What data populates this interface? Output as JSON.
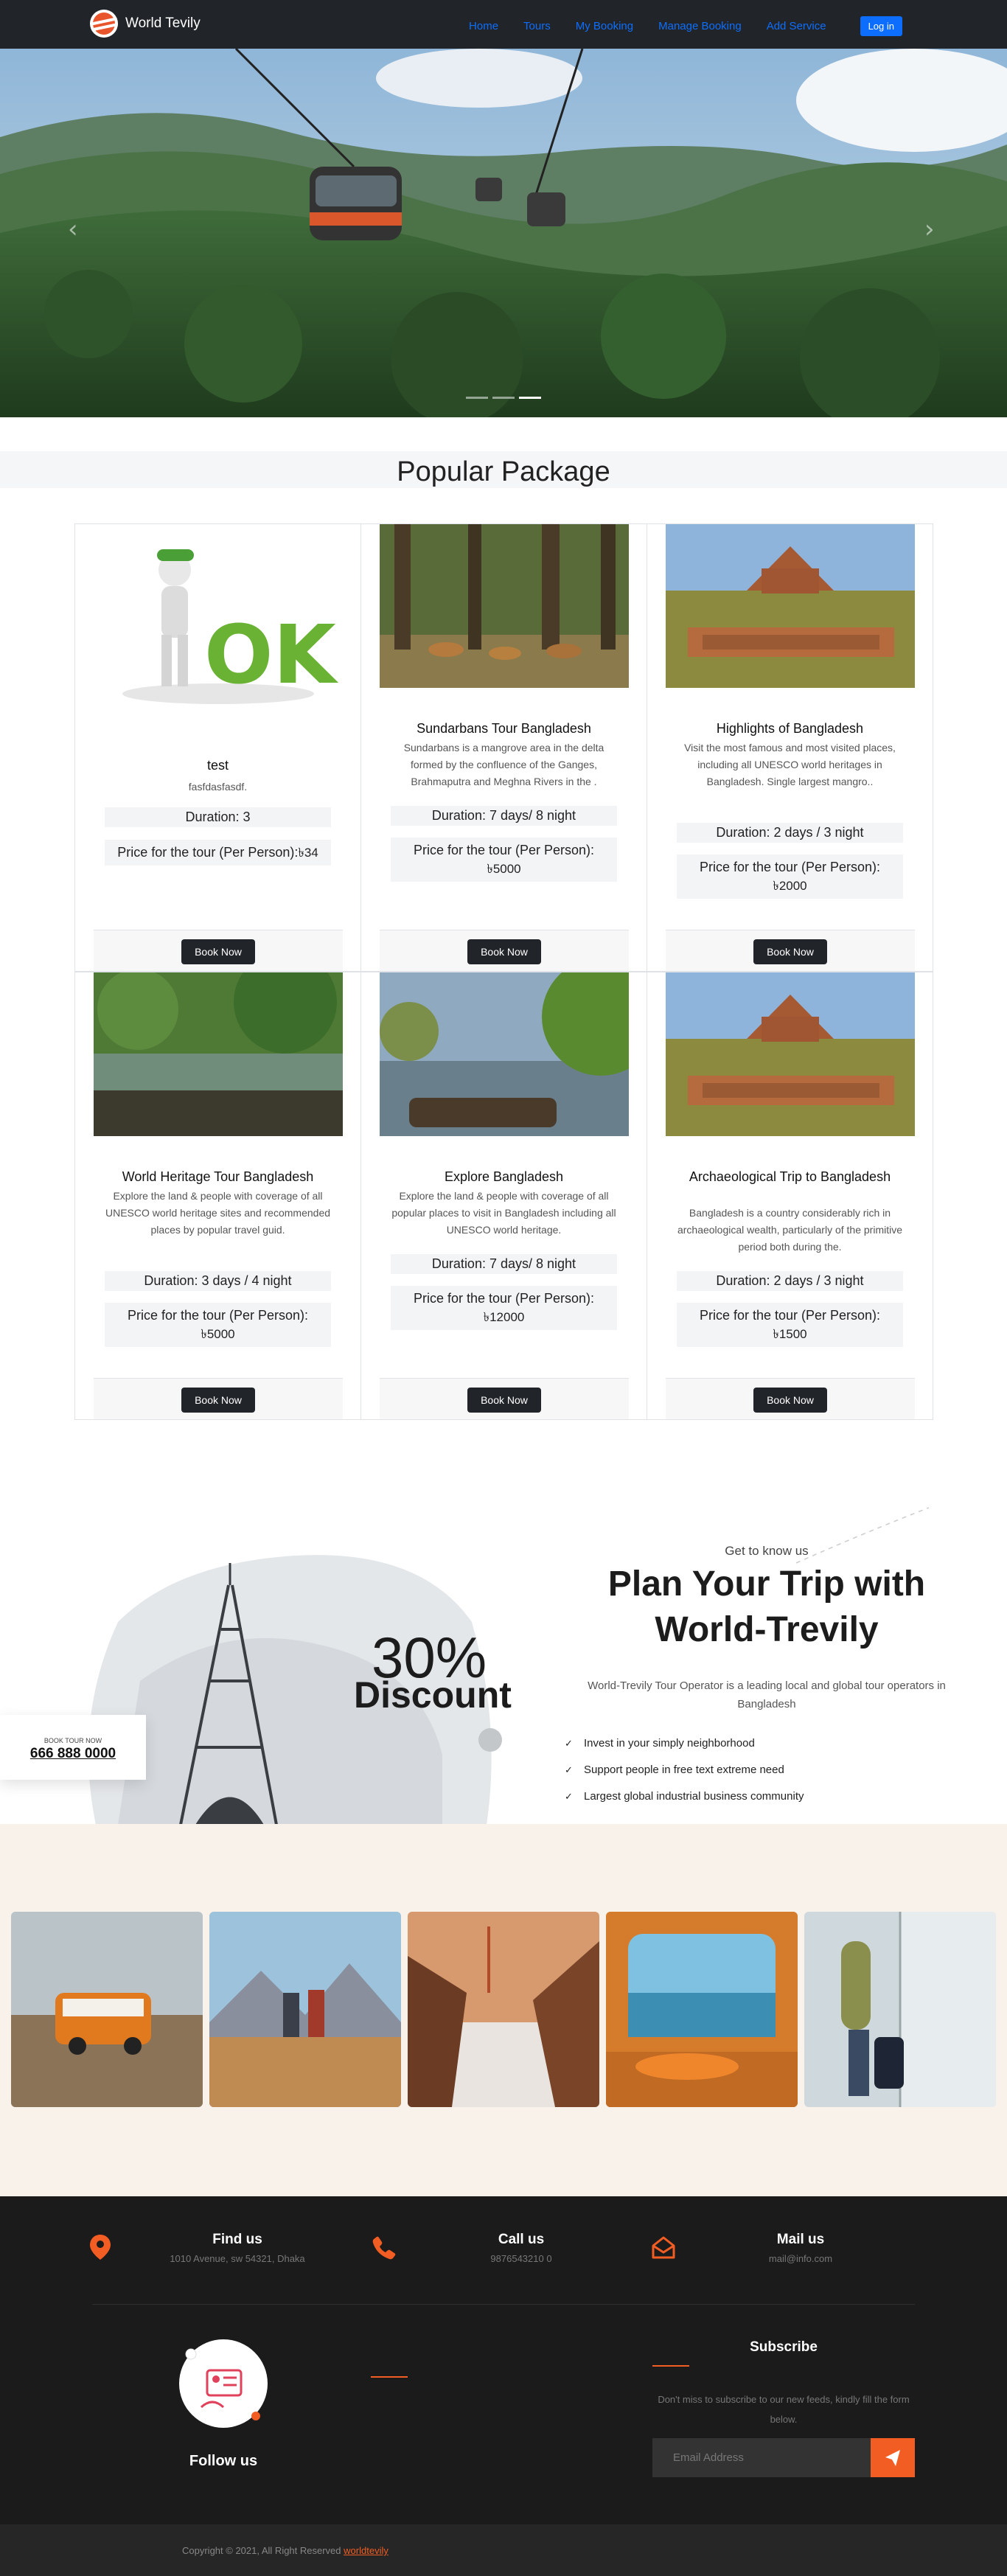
{
  "navbar": {
    "brand": "World Tevily",
    "links": [
      "Home",
      "Tours",
      "My Booking",
      "Manage Booking",
      "Add Service"
    ],
    "login": "Log in"
  },
  "hero": {
    "prev_icon": "chevron-left-icon",
    "next_icon": "chevron-right-icon",
    "slides": 3,
    "active_slide": 3
  },
  "popular": {
    "title": "Popular Package",
    "duration_prefix": "Duration: ",
    "price_label": "Price for the tour (Per Person):",
    "currency": "৳",
    "book_label": "Book Now",
    "cards": [
      {
        "title": "test",
        "desc": "fasfdasfasdf.",
        "duration": "3",
        "price": "34"
      },
      {
        "title": "Sundarbans Tour Bangladesh",
        "desc": "Sundarbans is a mangrove area in the delta formed by the confluence of the Ganges, Brahmaputra and Meghna Rivers in the .",
        "duration": "7 days/ 8 night",
        "price": "5000"
      },
      {
        "title": "Highlights of Bangladesh",
        "desc": "Visit the most famous and most visited places, including all UNESCO world heritages in Bangladesh. Single largest mangro..",
        "duration": "2 days / 3 night",
        "price": "2000"
      },
      {
        "title": "World Heritage Tour Bangladesh",
        "desc": "Explore the land & people with coverage of all UNESCO world heritage sites and recommended places by popular travel guid.",
        "duration": "3 days / 4 night",
        "price": "5000"
      },
      {
        "title": "Explore Bangladesh",
        "desc": "Explore the land & people with coverage of all popular places to visit in Bangladesh including all UNESCO world heritage.",
        "duration": "7 days/ 8 night",
        "price": "12000"
      },
      {
        "title": "Archaeological Trip to Bangladesh",
        "desc": "Bangladesh is a country considerably rich in archaeological wealth, particularly of the primitive period both during the.",
        "duration": "2 days / 3 night",
        "price": "1500"
      }
    ]
  },
  "trip": {
    "subtitle": "Get to know us",
    "title_line1": "Plan Your Trip with",
    "title_line2": "World-Trevily",
    "desc": "World-Trevily Tour Operator is a leading local and global tour operators in Bangladesh",
    "points": [
      "Invest in your simply neighborhood",
      "Support people in free text extreme need",
      "Largest global industrial business community"
    ],
    "discount_pct": "30%",
    "discount_word": "Discount",
    "book_label": "BOOK TOUR NOW",
    "phone": "666 888 0000"
  },
  "footer": {
    "find_title": "Find us",
    "find_text": "1010 Avenue, sw 54321, Dhaka",
    "call_title": "Call us",
    "call_text": "9876543210 0",
    "mail_title": "Mail us",
    "mail_text": "mail@info.com",
    "follow": "Follow us",
    "subscribe_title": "Subscribe",
    "subscribe_text": "Don't miss to subscribe to our new feeds, kindly fill the form below.",
    "email_placeholder": "Email Address",
    "copyright_prefix": "Copyright © 2021, All Right Reserved",
    "copyright_link": "worldtevily"
  },
  "colors": {
    "accent": "#f15d22",
    "primary": "#0d6efd",
    "dark": "#212529"
  }
}
